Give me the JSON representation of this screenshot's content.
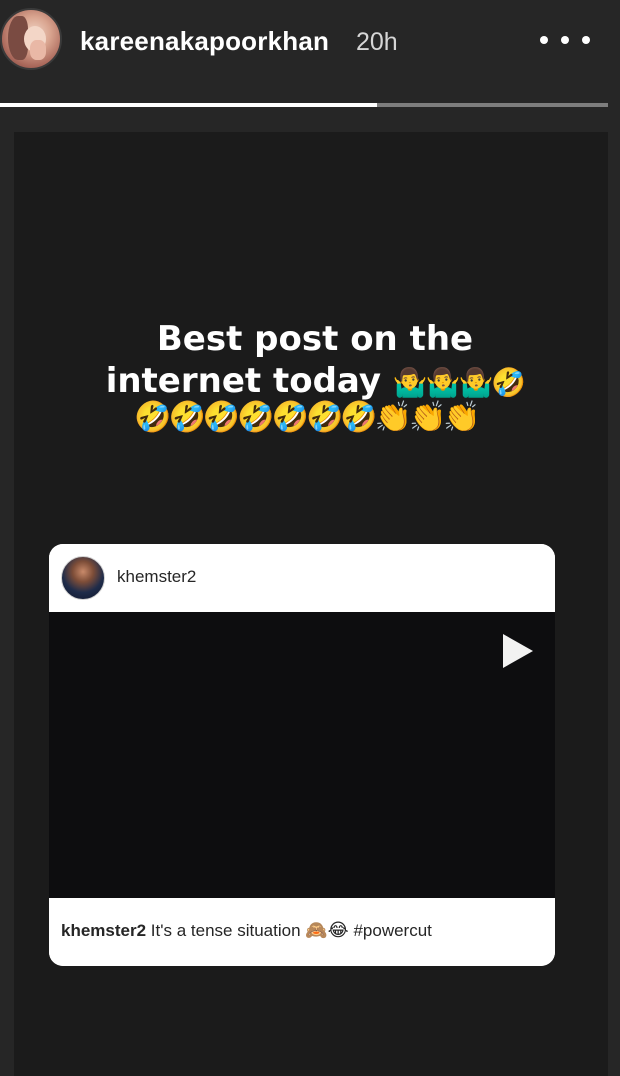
{
  "header": {
    "username": "kareenakapoorkhan",
    "time": "20h",
    "more_icon": "more-horizontal-icon"
  },
  "progress": {
    "fraction": 0.62
  },
  "caption": {
    "line1": "Best post on the",
    "line2_text": "internet today",
    "line2_emoji": "🤷‍♂️🤷‍♂️🤷‍♂️🤣",
    "line3_emoji": "🤣🤣🤣🤣🤣🤣🤣👏👏👏"
  },
  "post": {
    "username": "khemster2",
    "media_icon": "play-icon",
    "caption_user": "khemster2",
    "caption_text": "It's a tense situation",
    "caption_emoji": "🙈😂",
    "caption_tag": "#powercut"
  },
  "colors": {
    "background": "#262626",
    "canvas": "#1b1b1b",
    "progress_fill": "#ffffff",
    "progress_track": "#7d7d7d"
  }
}
